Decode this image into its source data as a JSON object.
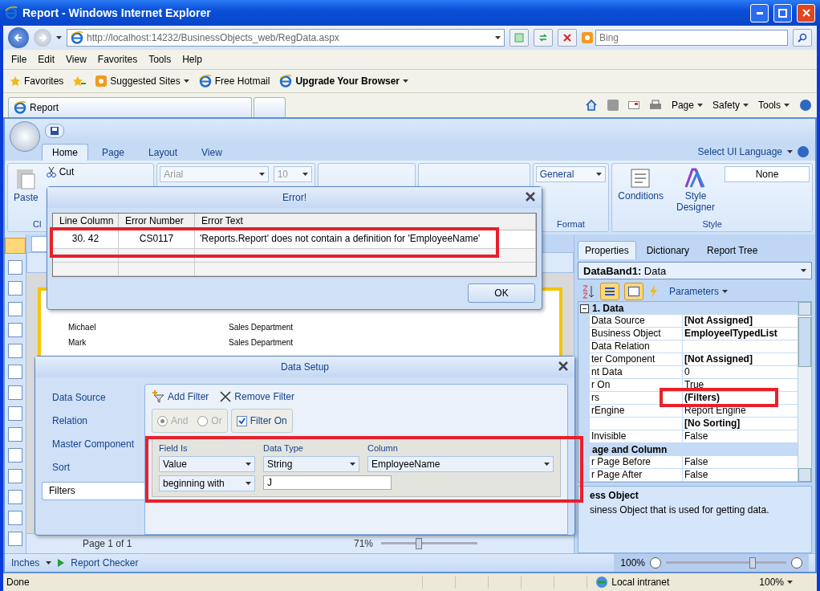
{
  "window": {
    "title": "Report - Windows Internet Explorer"
  },
  "address_bar": {
    "url": "http://localhost:14232/BusinessObjects_web/RegData.aspx",
    "search_placeholder": "Bing"
  },
  "menu": [
    "File",
    "Edit",
    "View",
    "Favorites",
    "Tools",
    "Help"
  ],
  "favorites_bar": {
    "label": "Favorites",
    "links": [
      {
        "label": "Suggested Sites",
        "bold": false,
        "dropdown": true
      },
      {
        "label": "Free Hotmail",
        "bold": false,
        "dropdown": false
      },
      {
        "label": "Upgrade Your Browser",
        "bold": true,
        "dropdown": true
      }
    ]
  },
  "browser_tab": {
    "label": "Report"
  },
  "command_bar": [
    "Page",
    "Safety",
    "Tools"
  ],
  "ribbon": {
    "tabs": [
      {
        "label": "Home",
        "selected": true
      },
      {
        "label": "Page",
        "selected": false
      },
      {
        "label": "Layout",
        "selected": false
      },
      {
        "label": "View",
        "selected": false
      }
    ],
    "language": "Select UI Language",
    "paste": "Paste",
    "cut": "Cut",
    "font": "Arial",
    "size": "10",
    "number_format": "General",
    "conditions": "Conditions",
    "style_designer": "Style Designer",
    "style_value": "None",
    "group_labels": [
      "Cl",
      "Format",
      "Style"
    ]
  },
  "report": {
    "rows": [
      {
        "name": "Michael",
        "department": "Sales Department"
      },
      {
        "name": "Mark",
        "department": "Sales Department"
      }
    ],
    "page": "Page 1 of 1",
    "zoom": "71%",
    "zoom_slider": {
      "level": 0.38
    }
  },
  "panel": {
    "tabs": [
      {
        "label": "Properties",
        "selected": true
      },
      {
        "label": "Dictionary",
        "selected": false
      },
      {
        "label": "Report Tree",
        "selected": false
      }
    ],
    "object": "**DataBand1:** Data",
    "parameters": "Parameters",
    "categories": [
      {
        "title": "1. Data",
        "properties": [
          {
            "name": "Data Source",
            "value": "[Not Assigned]",
            "bold": true
          },
          {
            "name": "Business Object",
            "value": "EmployeeITypedList",
            "bold": true
          },
          {
            "name": "Data Relation"
          },
          {
            "name": "ter Component",
            "value": "[Not Assigned]",
            "bold": true
          },
          {
            "name": "nt Data",
            "value": "0",
            "bold": false
          },
          {
            "name": "r On",
            "value": "True",
            "bold": false
          },
          {
            "name": "rs",
            "value": "(Filters)",
            "bold": true
          },
          {
            "name": "rEngine",
            "value": "Report Engine",
            "bold": false
          },
          {
            "value": "[No Sorting]",
            "bold": true
          },
          {
            "name": "Invisible",
            "value": "False",
            "bold": false
          }
        ]
      },
      {
        "title": "age and Column",
        "properties": [
          {
            "name": "r Page Before",
            "value": "False",
            "bold": false
          },
          {
            "name": "r Page After",
            "value": "False",
            "bold": false
          }
        ]
      }
    ],
    "description_title": "ess Object",
    "description": "siness Object that is used for getting data."
  },
  "app_status": {
    "units": "Inches",
    "checker": "Report Checker",
    "zoom": "100%",
    "zoom_slider": {
      "level": 0.73
    }
  },
  "ie_status": {
    "text": "Done",
    "zone": "Local intranet",
    "zoom": "100%"
  },
  "error_dialog": {
    "title": "Error!",
    "columns": [
      "Line Column",
      "Error Number",
      "Error Text"
    ],
    "rows": [
      [
        "30. 42",
        "CS0117",
        "'Reports.Report' does not contain a definition for 'EmployeeName'"
      ]
    ],
    "ok": "OK"
  },
  "data_setup": {
    "title": "Data Setup",
    "nav": [
      {
        "label": "Data Source",
        "selected": false
      },
      {
        "label": "Relation",
        "selected": false
      },
      {
        "label": "Master Component",
        "selected": false
      },
      {
        "label": "Sort",
        "selected": false
      },
      {
        "label": "Filters",
        "selected": true
      }
    ],
    "add_filter": "Add Filter",
    "remove_filter": "Remove Filter",
    "logic_disabled": true,
    "logic": [
      {
        "label": "And",
        "selected": true
      },
      {
        "label": "Or",
        "selected": false
      }
    ],
    "filter_on": {
      "label": "Filter On",
      "checked": true
    },
    "filter": {
      "labels": [
        "Field Is",
        "Data Type",
        "Column"
      ],
      "field_is": "Value",
      "data_type": "String",
      "column": "EmployeeName",
      "condition": "beginning with",
      "value": "J"
    }
  }
}
